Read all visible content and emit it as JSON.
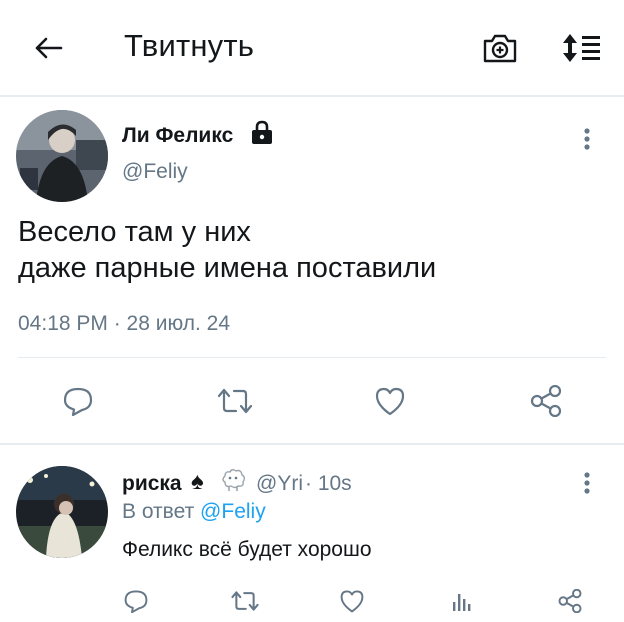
{
  "header": {
    "back_icon": "arrow-left-icon",
    "title": "Твитнуть",
    "camera_icon": "camera-add-icon",
    "sort_icon": "sort-list-icon"
  },
  "tweet": {
    "author_name": "Ли Феликс",
    "lock_icon": "lock-icon",
    "handle": "@Feliy",
    "text": "Весело там у них\nдаже парные имена  поставили",
    "timestamp": "04:18 PM · 28 июл. 24",
    "actions": [
      "reply-icon",
      "retweet-icon",
      "like-icon",
      "share-icon"
    ],
    "more_icon": "more-vertical-icon"
  },
  "reply": {
    "author_name": "риска",
    "emoji": [
      "♠",
      "🐑"
    ],
    "handle": "@Yri",
    "time": "· 10s",
    "reply_prefix": "В ответ",
    "reply_mention": "@Feliy",
    "text": "Феликс всё будет хорошо",
    "actions": [
      "reply-icon",
      "retweet-icon",
      "like-icon",
      "analytics-icon",
      "share-icon"
    ],
    "more_icon": "more-vertical-icon"
  },
  "colors": {
    "text": "#14171a",
    "secondary": "#657786",
    "link": "#1da1f2",
    "divider": "#e6ecf0"
  }
}
